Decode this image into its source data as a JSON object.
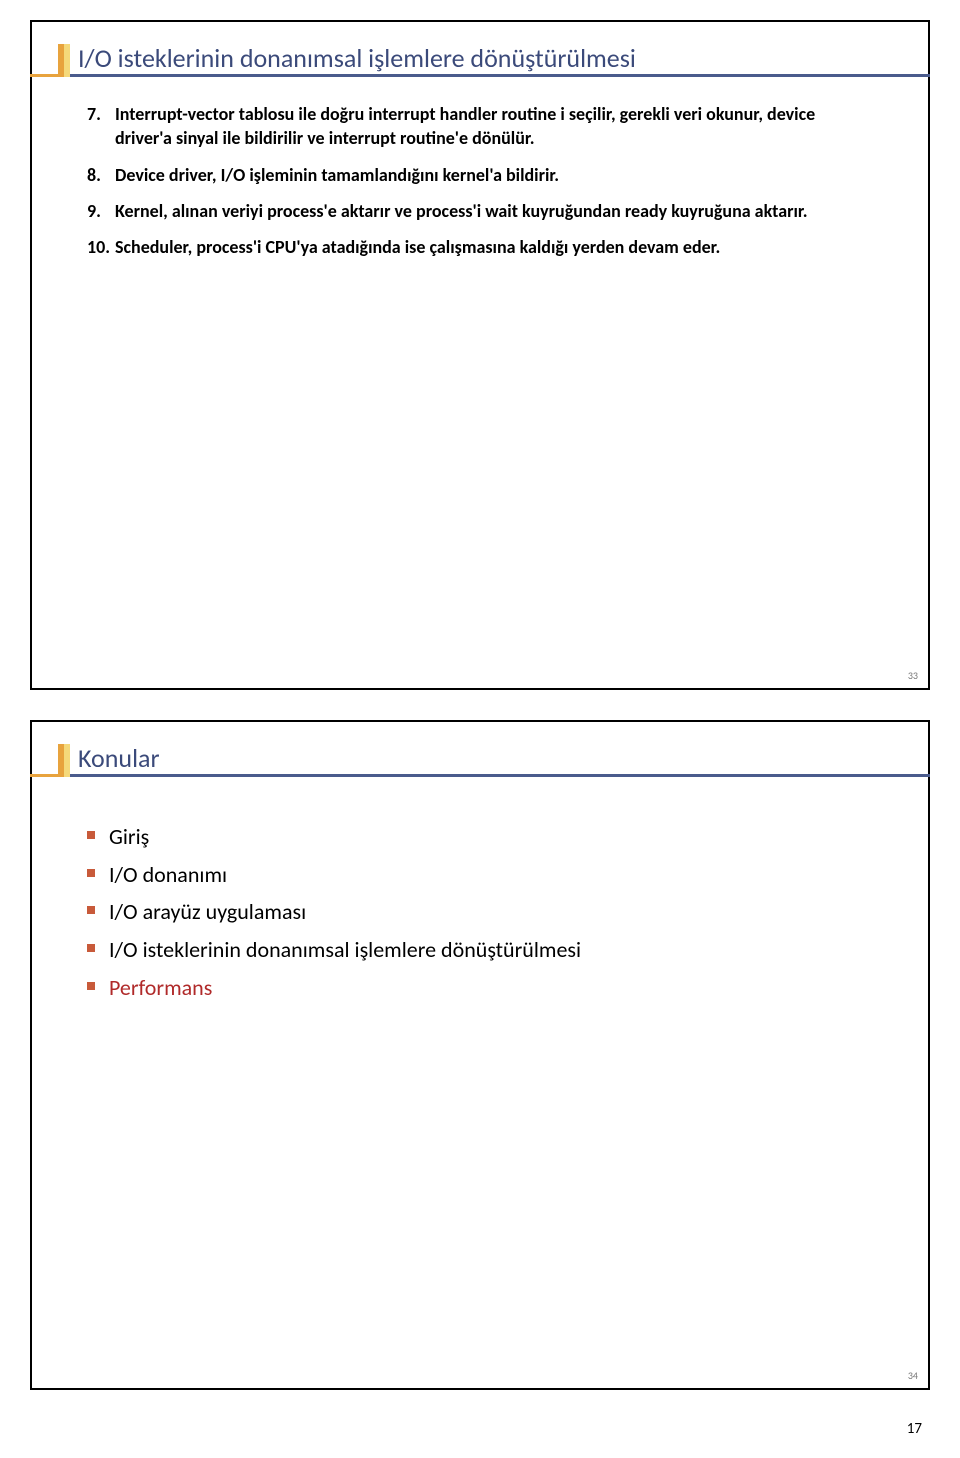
{
  "slide1": {
    "title": "I/O isteklerinin donanımsal işlemlere dönüştürülmesi",
    "items": [
      {
        "num": "7.",
        "text": "Interrupt-vector tablosu ile doğru interrupt handler routine i seçilir, gerekli veri okunur, device driver'a sinyal ile bildirilir ve interrupt routine'e dönülür."
      },
      {
        "num": "8.",
        "text": "Device driver, I/O işleminin tamamlandığını kernel'a bildirir."
      },
      {
        "num": "9.",
        "text": "Kernel, alınan veriyi process'e aktarır ve process'i wait kuyruğundan ready kuyruğuna aktarır."
      },
      {
        "num": "10.",
        "text": "Scheduler, process'i CPU'ya atadığında ise çalışmasına kaldığı yerden devam eder."
      }
    ],
    "pagenum": "33"
  },
  "slide2": {
    "title": "Konular",
    "bullets": [
      {
        "text": "Giriş",
        "red": false
      },
      {
        "text": "I/O donanımı",
        "red": false
      },
      {
        "text": "I/O arayüz uygulaması",
        "red": false
      },
      {
        "text": "I/O isteklerinin donanımsal işlemlere dönüştürülmesi",
        "red": false
      },
      {
        "text": "Performans",
        "red": true
      }
    ],
    "pagenum": "34"
  },
  "footer": "17"
}
